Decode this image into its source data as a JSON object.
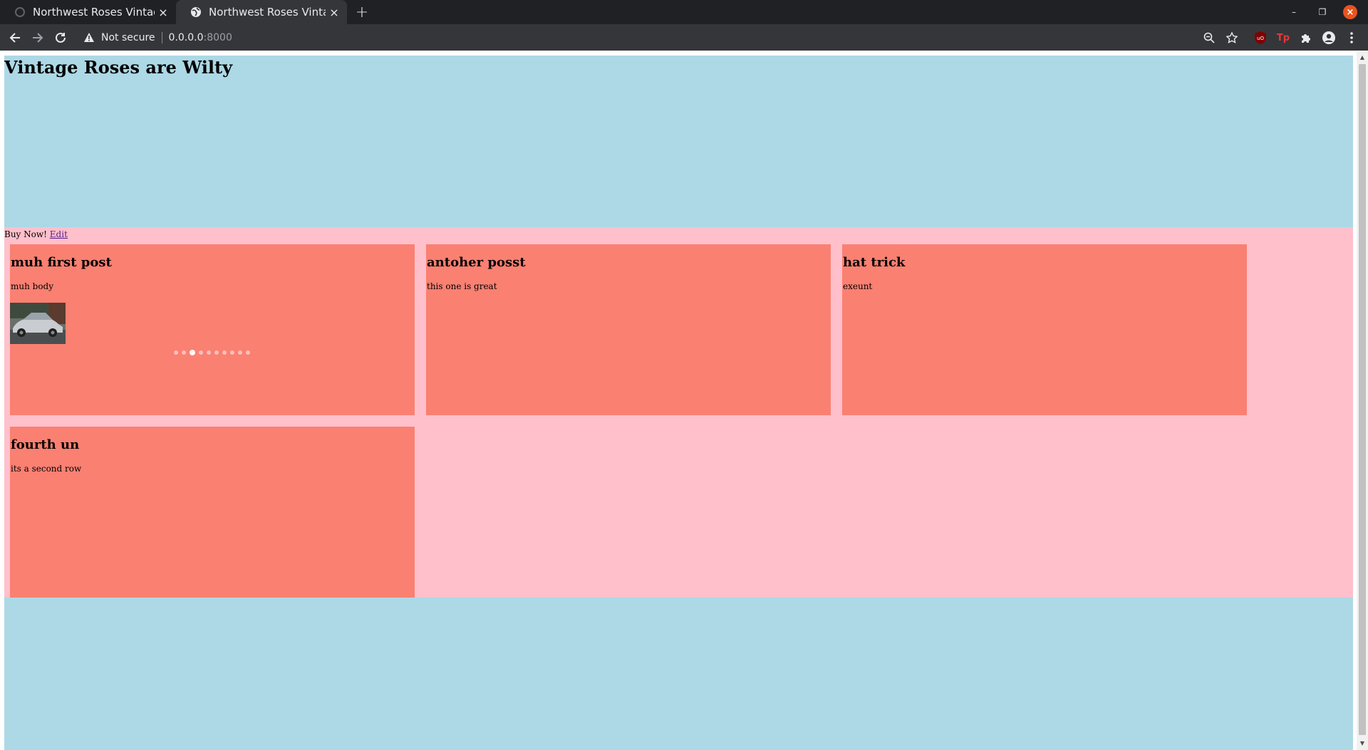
{
  "browser": {
    "tabs": [
      {
        "title": "Northwest Roses Vintage",
        "active": false,
        "close_glyph": "×"
      },
      {
        "title": "Northwest Roses Vintage",
        "active": true,
        "close_glyph": "×"
      }
    ],
    "new_tab_glyph": "+",
    "security_label": "Not secure",
    "url_host": "0.0.0.0",
    "url_port": ":8000",
    "icons": {
      "back": "back-arrow-icon",
      "forward": "forward-arrow-icon",
      "reload": "reload-icon",
      "warning": "warning-triangle-icon",
      "zoom": "zoom-icon",
      "bookmark": "star-icon",
      "ublock": "ublock-shield-icon",
      "tp": "tp-extension-icon",
      "extensions": "puzzle-icon",
      "profile": "profile-icon",
      "menu": "kebab-menu-icon"
    },
    "tp_label": "Tp",
    "window_controls": {
      "minimize": "–",
      "restore": "❐",
      "close": "×"
    }
  },
  "page": {
    "heading": "Vintage Roses are Wilty",
    "buy_text": "Buy Now!",
    "edit_link": "Edit",
    "posts": [
      {
        "title": "muh first post",
        "body": "muh body",
        "has_image": true,
        "carousel_count": 10,
        "carousel_active": 2
      },
      {
        "title": "antoher posst",
        "body": "this one is great",
        "has_image": false
      },
      {
        "title": "hat trick",
        "body": "exeunt",
        "has_image": false
      },
      {
        "title": "fourth un",
        "body": "its a second row",
        "has_image": false
      }
    ]
  },
  "colors": {
    "hero_bg": "#add8e6",
    "main_bg": "#ffc0cb",
    "card_bg": "#fa8072",
    "chrome_dark": "#202124",
    "chrome_toolbar": "#35363a"
  }
}
